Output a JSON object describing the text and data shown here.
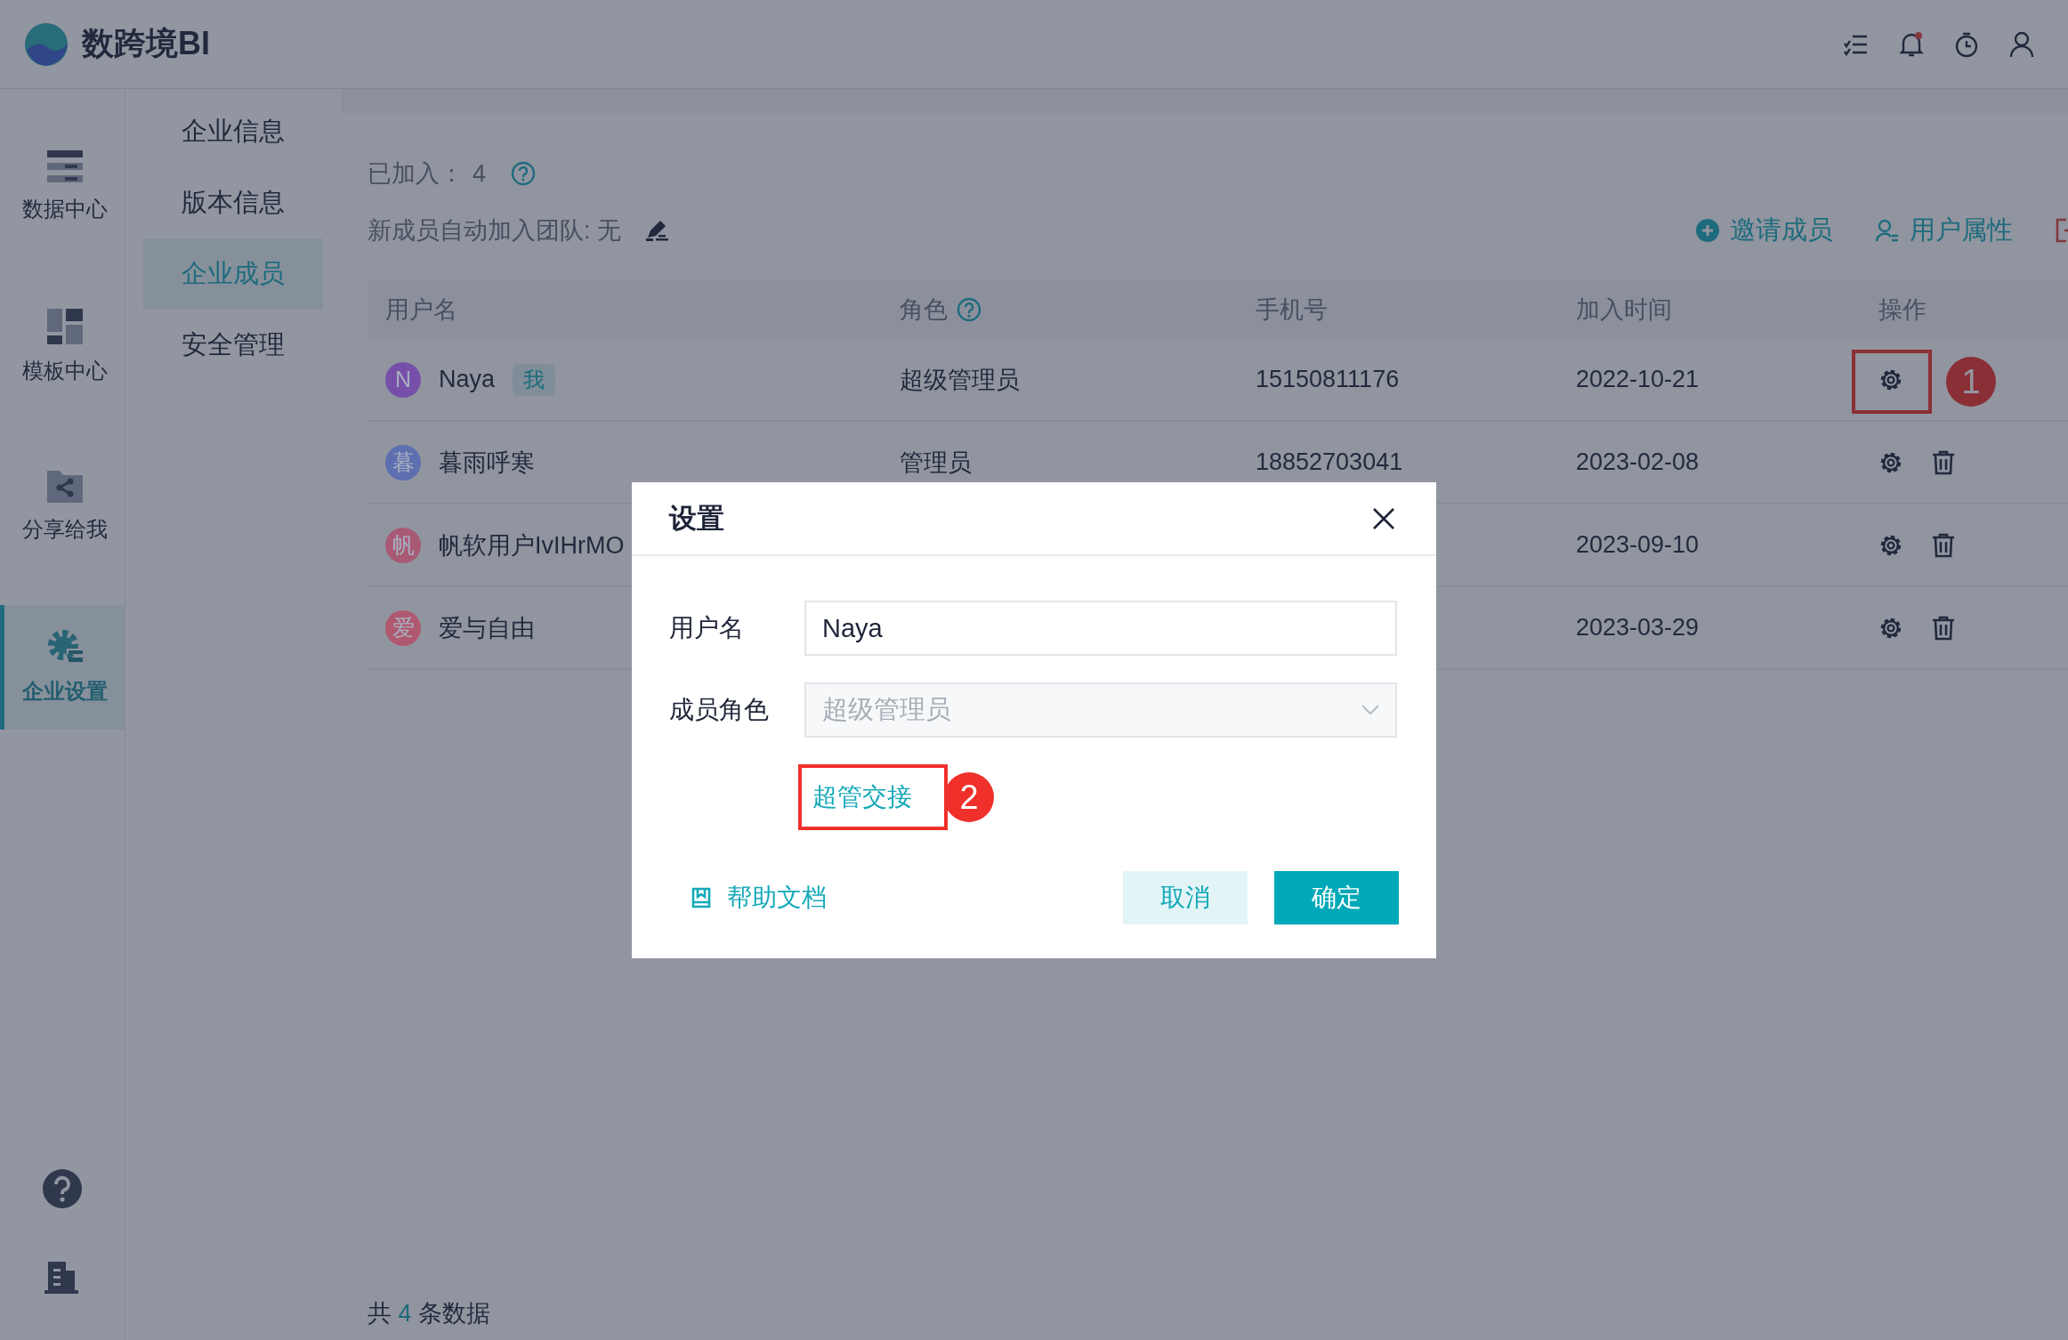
{
  "app": {
    "name": "数跨境BI"
  },
  "nav": [
    {
      "label": "数据中心",
      "selected": false,
      "kind": "data"
    },
    {
      "label": "模板中心",
      "selected": false,
      "kind": "template"
    },
    {
      "label": "分享给我",
      "selected": false,
      "kind": "share"
    },
    {
      "label": "企业设置",
      "selected": true,
      "kind": "settings"
    }
  ],
  "submenu": [
    {
      "label": "企业信息",
      "selected": false
    },
    {
      "label": "版本信息",
      "selected": false
    },
    {
      "label": "企业成员",
      "selected": true
    },
    {
      "label": "安全管理",
      "selected": false
    }
  ],
  "summary": {
    "joined_label": "已加入：",
    "joined_count": "4",
    "auto_join": "新成员自动加入团队: 无"
  },
  "actions": [
    {
      "label": "邀请成员",
      "kind": "invite"
    },
    {
      "label": "用户属性",
      "kind": "attributes"
    }
  ],
  "table": {
    "columns": [
      "用户名",
      "角色",
      "手机号",
      "加入时间",
      "操作"
    ],
    "rows": [
      {
        "avatar": "N",
        "color": "#7650a8",
        "name": "Naya",
        "tag": "我",
        "role": "超级管理员",
        "phone": "15150811176",
        "joined": "2022-10-21",
        "deletable": false
      },
      {
        "avatar": "暮",
        "color": "#5d6fb0",
        "name": "暮雨呼寒",
        "role": "管理员",
        "phone": "18852703041",
        "joined": "2023-02-08",
        "deletable": true
      },
      {
        "avatar": "帆",
        "color": "#a85a74",
        "name": "帆软用户IvIHrMO",
        "joined": "2023-09-10",
        "deletable": true
      },
      {
        "avatar": "爱",
        "color": "#b05870",
        "name": "爱与自由",
        "joined": "2023-03-29",
        "deletable": true
      }
    ]
  },
  "footer": {
    "prefix": "共",
    "count": "4",
    "suffix": "条数据"
  },
  "dialog": {
    "title": "设置",
    "fields": [
      {
        "label": "用户名",
        "kind": "input",
        "value": "Naya",
        "disabled": false
      },
      {
        "label": "成员角色",
        "kind": "select",
        "value": "超级管理员",
        "disabled": true
      }
    ],
    "link": "超管交接",
    "help": "帮助文档",
    "buttons": [
      {
        "label": "取消",
        "kind": "secondary"
      },
      {
        "label": "确定",
        "kind": "primary"
      }
    ]
  },
  "annotations": [
    "1",
    "2"
  ]
}
